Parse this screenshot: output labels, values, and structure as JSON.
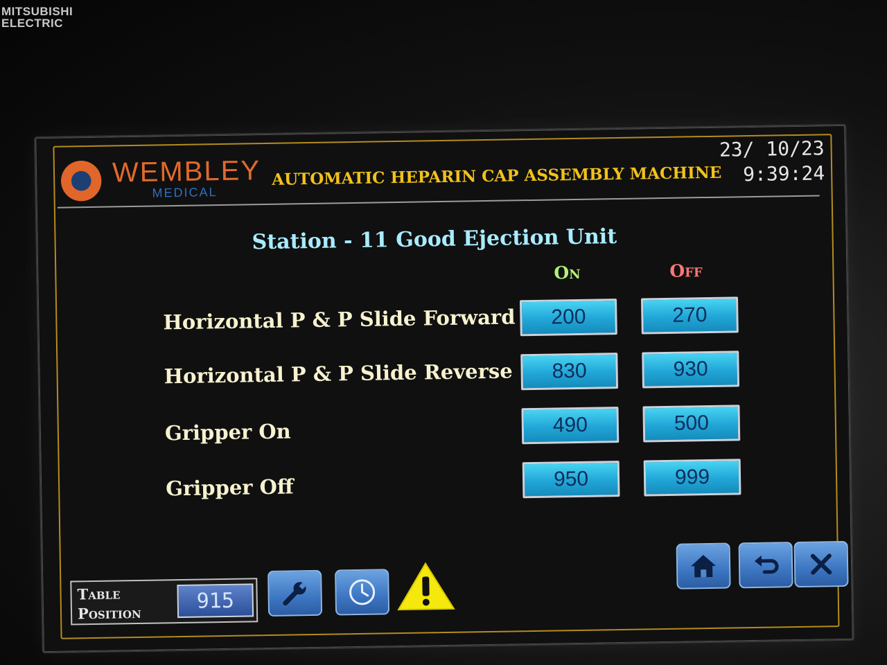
{
  "bezel": {
    "brand_line1": "MITSUBISHI",
    "brand_line2": "ELECTRIC"
  },
  "header": {
    "logo_name": "WEMBLEY",
    "logo_sub": "MEDICAL",
    "app_title": "AUTOMATIC HEPARIN CAP ASSEMBLY MACHINE",
    "date": "23/ 10/23",
    "time": "9:39:24"
  },
  "page": {
    "title": "Station - 11 Good Ejection Unit",
    "col_on": "On",
    "col_off": "Off"
  },
  "rows": [
    {
      "label": "Horizontal P & P Slide Forward",
      "on": "200",
      "off": "270"
    },
    {
      "label": "Horizontal P & P Slide Reverse",
      "on": "830",
      "off": "930"
    },
    {
      "label": "Gripper On",
      "on": "490",
      "off": "500"
    },
    {
      "label": "Gripper Off",
      "on": "950",
      "off": "999"
    }
  ],
  "footer": {
    "table_position_label": "Table Position",
    "table_position_value": "915",
    "buttons": [
      "wrench-icon",
      "clock-icon",
      "warning-icon",
      "home-icon",
      "back-icon",
      "close-icon"
    ]
  },
  "colors": {
    "title_gold": "#f2c21b",
    "page_title": "#a8ecff",
    "on_green": "#b3f07a",
    "off_red": "#ff7777",
    "value_cyan": "#21a6d7",
    "button_blue": "#3d76c2",
    "frame_gold": "#b58c1e"
  }
}
